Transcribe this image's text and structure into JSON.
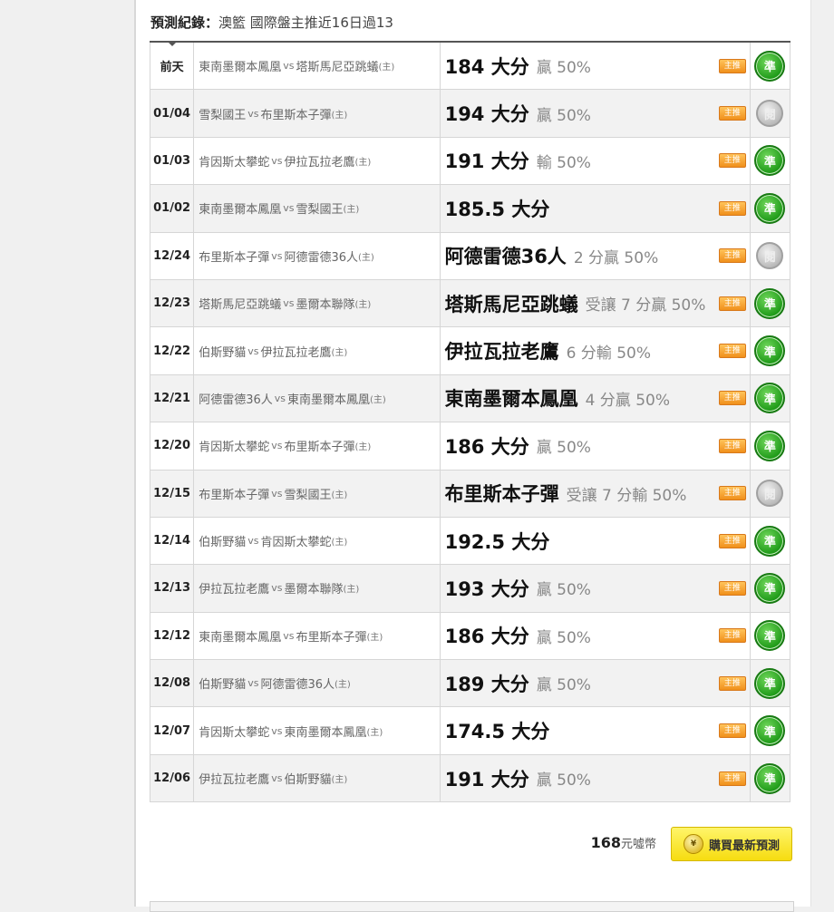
{
  "header": {
    "label": "預測紀錄：",
    "value": "澳籃 國際盤主推近16日過13"
  },
  "records": [
    {
      "date": "前天",
      "away": "東南墨爾本鳳凰",
      "home": "塔斯馬尼亞跳蟻",
      "pick": "184 大分",
      "detail": "贏 50%",
      "tag": "主推",
      "result": "準",
      "status": "win"
    },
    {
      "date": "01/04",
      "away": "雪梨國王",
      "home": "布里斯本子彈",
      "pick": "194 大分",
      "detail": "贏 50%",
      "tag": "主推",
      "result": "閱",
      "status": "pending"
    },
    {
      "date": "01/03",
      "away": "肯因斯太攀蛇",
      "home": "伊拉瓦拉老鷹",
      "pick": "191 大分",
      "detail": "輸 50%",
      "tag": "主推",
      "result": "準",
      "status": "win"
    },
    {
      "date": "01/02",
      "away": "東南墨爾本鳳凰",
      "home": "雪梨國王",
      "pick": "185.5 大分",
      "detail": "",
      "tag": "主推",
      "result": "準",
      "status": "win"
    },
    {
      "date": "12/24",
      "away": "布里斯本子彈",
      "home": "阿德雷德36人",
      "pick": "阿德雷德36人",
      "detail": "2 分贏 50%",
      "tag": "主推",
      "result": "閱",
      "status": "pending"
    },
    {
      "date": "12/23",
      "away": "塔斯馬尼亞跳蟻",
      "home": "墨爾本聯隊",
      "pick": "塔斯馬尼亞跳蟻",
      "detail": "受讓 7 分贏 50%",
      "tag": "主推",
      "result": "準",
      "status": "win"
    },
    {
      "date": "12/22",
      "away": "伯斯野貓",
      "home": "伊拉瓦拉老鷹",
      "pick": "伊拉瓦拉老鷹",
      "detail": "6 分輸 50%",
      "tag": "主推",
      "result": "準",
      "status": "win"
    },
    {
      "date": "12/21",
      "away": "阿德雷德36人",
      "home": "東南墨爾本鳳凰",
      "pick": "東南墨爾本鳳凰",
      "detail": "4 分贏 50%",
      "tag": "主推",
      "result": "準",
      "status": "win"
    },
    {
      "date": "12/20",
      "away": "肯因斯太攀蛇",
      "home": "布里斯本子彈",
      "pick": "186 大分",
      "detail": "贏 50%",
      "tag": "主推",
      "result": "準",
      "status": "win"
    },
    {
      "date": "12/15",
      "away": "布里斯本子彈",
      "home": "雪梨國王",
      "pick": "布里斯本子彈",
      "detail": "受讓 7 分輸 50%",
      "tag": "主推",
      "result": "閱",
      "status": "pending"
    },
    {
      "date": "12/14",
      "away": "伯斯野貓",
      "home": "肯因斯太攀蛇",
      "pick": "192.5 大分",
      "detail": "",
      "tag": "主推",
      "result": "準",
      "status": "win"
    },
    {
      "date": "12/13",
      "away": "伊拉瓦拉老鷹",
      "home": "墨爾本聯隊",
      "pick": "193 大分",
      "detail": "贏 50%",
      "tag": "主推",
      "result": "準",
      "status": "win"
    },
    {
      "date": "12/12",
      "away": "東南墨爾本鳳凰",
      "home": "布里斯本子彈",
      "pick": "186 大分",
      "detail": "贏 50%",
      "tag": "主推",
      "result": "準",
      "status": "win"
    },
    {
      "date": "12/08",
      "away": "伯斯野貓",
      "home": "阿德雷德36人",
      "pick": "189 大分",
      "detail": "贏 50%",
      "tag": "主推",
      "result": "準",
      "status": "win"
    },
    {
      "date": "12/07",
      "away": "肯因斯太攀蛇",
      "home": "東南墨爾本鳳凰",
      "pick": "174.5 大分",
      "detail": "",
      "tag": "主推",
      "result": "準",
      "status": "win"
    },
    {
      "date": "12/06",
      "away": "伊拉瓦拉老鷹",
      "home": "伯斯野貓",
      "pick": "191 大分",
      "detail": "贏 50%",
      "tag": "主推",
      "result": "準",
      "status": "win"
    }
  ],
  "labels": {
    "vs": "vs",
    "home_marker": "(主)"
  },
  "footer": {
    "price_value": "168",
    "price_unit": "元噓幣",
    "coin_icon": "coin-icon",
    "buy_label": "購買最新預測"
  },
  "colors": {
    "win": "#1e9a18",
    "pending": "#b8b8b8",
    "tag": "#f0901c",
    "buy": "#f6dc10"
  }
}
